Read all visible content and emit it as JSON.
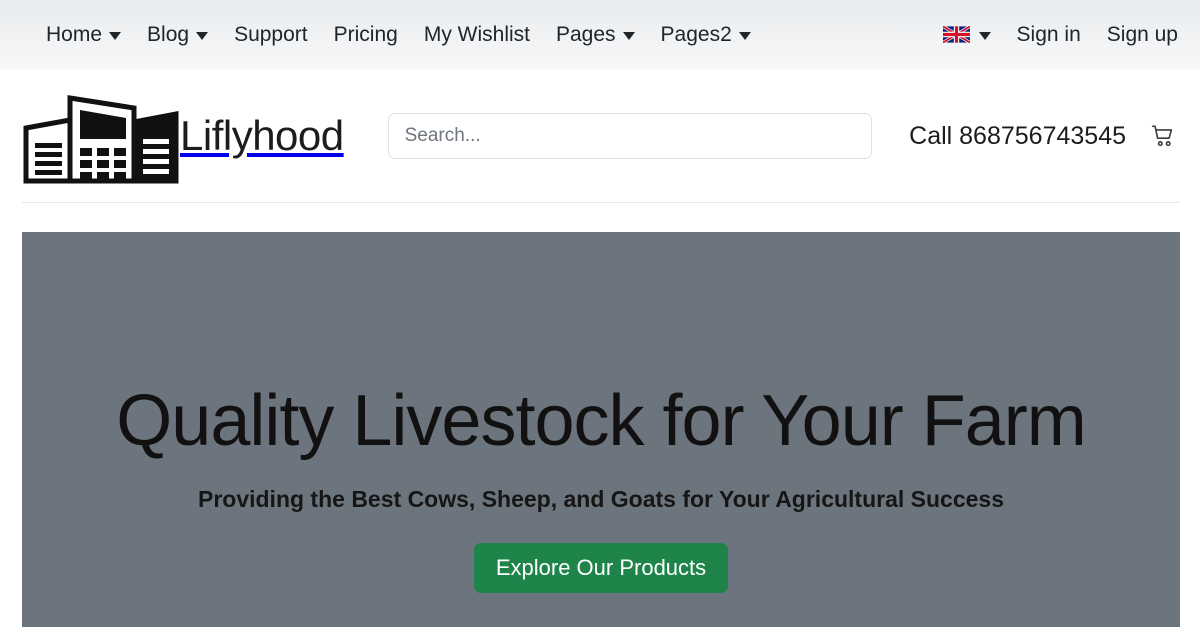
{
  "topbar": {
    "nav_items": [
      {
        "label": "Home",
        "has_dropdown": true
      },
      {
        "label": "Blog",
        "has_dropdown": true
      },
      {
        "label": "Support",
        "has_dropdown": false
      },
      {
        "label": "Pricing",
        "has_dropdown": false
      },
      {
        "label": "My Wishlist",
        "has_dropdown": false
      },
      {
        "label": "Pages",
        "has_dropdown": true
      },
      {
        "label": "Pages2",
        "has_dropdown": true
      }
    ],
    "language": {
      "icon": "uk-flag-icon",
      "selected": "English (UK)",
      "has_dropdown": true
    },
    "sign_in_label": "Sign in",
    "sign_up_label": "Sign up"
  },
  "header": {
    "logo_icon": "buildings-logo-icon",
    "brand_name": "Liflyhood",
    "search": {
      "placeholder": "Search...",
      "value": "",
      "icon": "search-icon"
    },
    "call_label": "Call 868756743545",
    "cart_icon": "shopping-cart-icon"
  },
  "hero": {
    "title": "Quality Livestock for Your Farm",
    "subtitle": "Providing the Best Cows, Sheep, and Goats for Your Agricultural Success",
    "cta_label": "Explore Our Products"
  },
  "colors": {
    "hero_background": "#6c757d",
    "cta_green": "#1e8449",
    "topbar_gradient_top": "#e8ebed",
    "topbar_gradient_bottom": "#f7f8f9",
    "text_dark": "#212529",
    "divider": "#e6e6e6"
  }
}
